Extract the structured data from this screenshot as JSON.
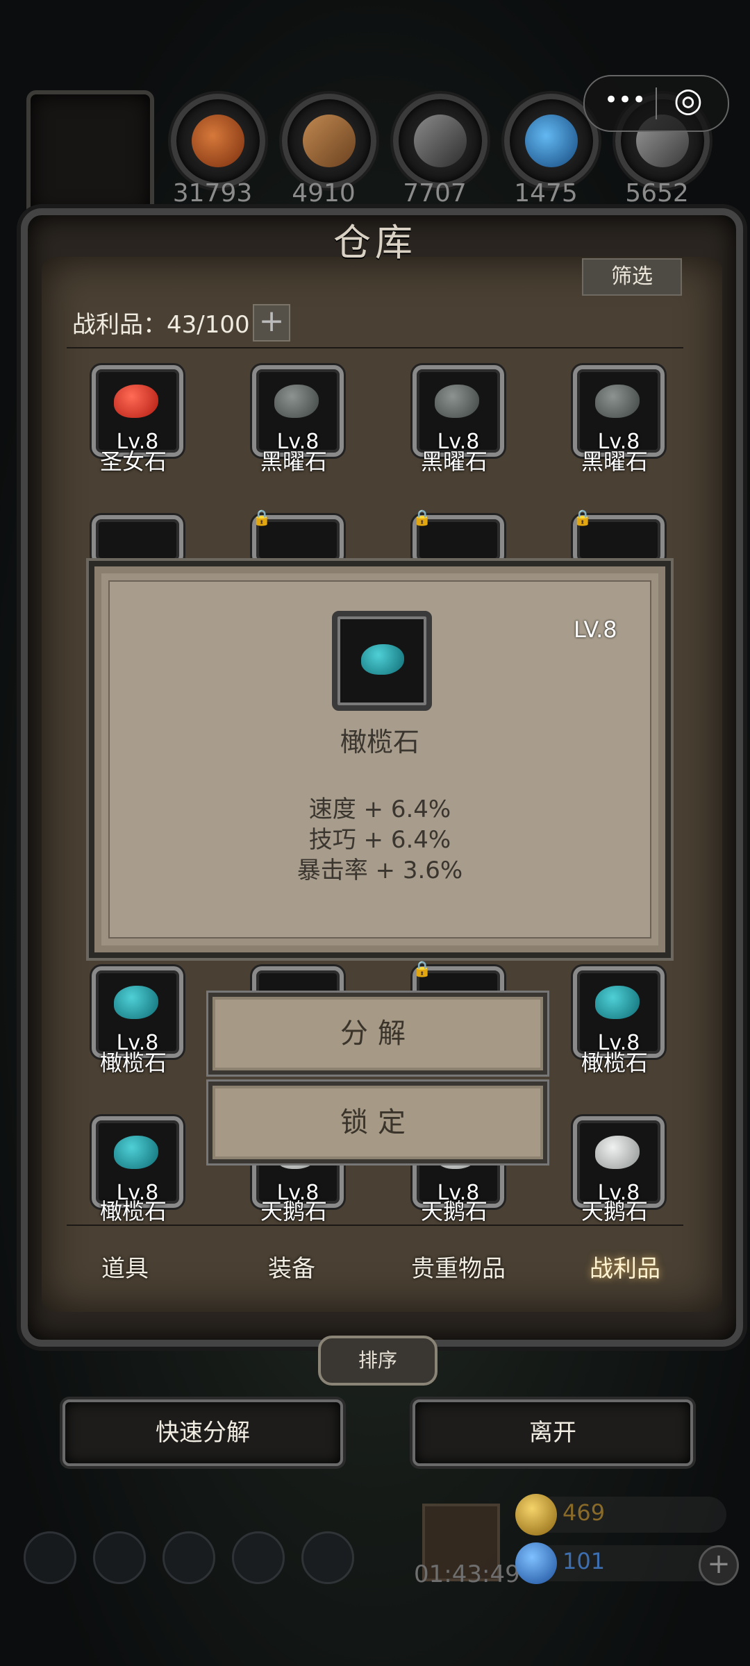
{
  "resources": [
    {
      "icon": "meat-icon",
      "value": "31793",
      "color": "#b5541f"
    },
    {
      "icon": "wood-icon",
      "value": "4910",
      "color": "#a07040"
    },
    {
      "icon": "iron-icon",
      "value": "7707",
      "color": "#5e5e5e"
    },
    {
      "icon": "crystal-icon",
      "value": "1475",
      "color": "#2f7fc4"
    },
    {
      "icon": "ingot-icon",
      "value": "5652",
      "color": "#6a6a6a"
    }
  ],
  "capsule": {
    "more": "•••",
    "close": "◎"
  },
  "warehouse": {
    "title": "仓库",
    "filter": "筛选",
    "count_label": "战利品：43/100",
    "add": "+"
  },
  "slots_row1": [
    {
      "lv": "Lv.8",
      "name": "圣女石",
      "gem_color": "#d8291b"
    },
    {
      "lv": "Lv.8",
      "name": "黑曜石",
      "gem_color": "#5e6664"
    },
    {
      "lv": "Lv.8",
      "name": "黑曜石",
      "gem_color": "#5e6664"
    },
    {
      "lv": "Lv.8",
      "name": "黑曜石",
      "gem_color": "#5e6664"
    }
  ],
  "slots_row4": [
    {
      "lv": "Lv.8",
      "name": "橄榄石",
      "gem_color": "#1d8f99"
    },
    {
      "lv": "Lv.8",
      "name": "橄榄石",
      "gem_color": "#1d8f99"
    }
  ],
  "slots_row5": [
    {
      "lv": "Lv.8",
      "name": "橄榄石",
      "gem_color": "#1d8f99"
    },
    {
      "lv": "Lv.8",
      "name": "天鹅石",
      "gem_color": "#c9cccb"
    },
    {
      "lv": "Lv.8",
      "name": "天鹅石",
      "gem_color": "#c9cccb"
    },
    {
      "lv": "Lv.8",
      "name": "天鹅石",
      "gem_color": "#c9cccb"
    }
  ],
  "popup": {
    "level": "LV.8",
    "name": "橄榄石",
    "gem_color": "#1d8f99",
    "stats": [
      "速度 + 6.4%",
      "技巧 + 6.4%",
      "暴击率 + 3.6%"
    ]
  },
  "actions": {
    "decompose": "分解",
    "lock": "锁定"
  },
  "tabs": [
    "道具",
    "装备",
    "贵重物品",
    "战利品"
  ],
  "active_tab": "战利品",
  "sort": "排序",
  "buttons": {
    "quick_decompose": "快速分解",
    "leave": "离开"
  },
  "bottom": {
    "timer": "01:43:49",
    "gold": "469",
    "gems": "101"
  },
  "colors": {
    "accent_gold": "#c89a2e",
    "accent_blue": "#3a7bd5"
  }
}
